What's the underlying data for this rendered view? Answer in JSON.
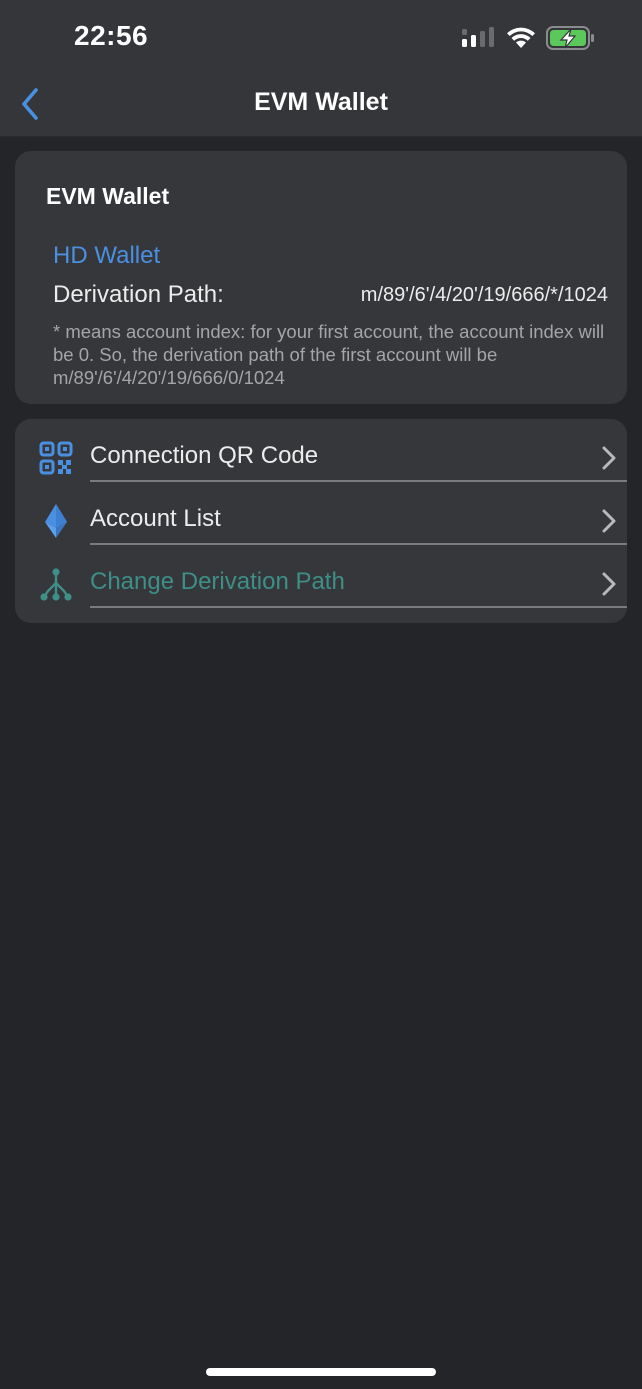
{
  "status_bar": {
    "time": "22:56",
    "icons": [
      "cellular-signal-icon",
      "wifi-icon",
      "battery-charging-icon"
    ]
  },
  "nav": {
    "title": "EVM Wallet",
    "back_icon": "chevron-left-icon"
  },
  "wallet_card": {
    "title": "EVM Wallet",
    "type": "HD Wallet",
    "derivation_label": "Derivation Path:",
    "derivation_value": "m/89'/6'/4/20'/19/666/*/1024",
    "note": "* means account index: for your first account, the account index will be 0. So, the derivation path of the first account will be m/89'/6'/4/20'/19/666/0/1024"
  },
  "menu": {
    "items": [
      {
        "label": "Connection QR Code",
        "icon": "qr-code-icon"
      },
      {
        "label": "Account List",
        "icon": "ethereum-icon"
      },
      {
        "label": "Change Derivation Path",
        "icon": "derivation-tree-icon"
      }
    ]
  },
  "colors": {
    "background": "#232528",
    "card": "#36373b",
    "accent_blue": "#4a90e2",
    "accent_teal": "#3d8f88",
    "battery_green": "#5ac85a"
  }
}
